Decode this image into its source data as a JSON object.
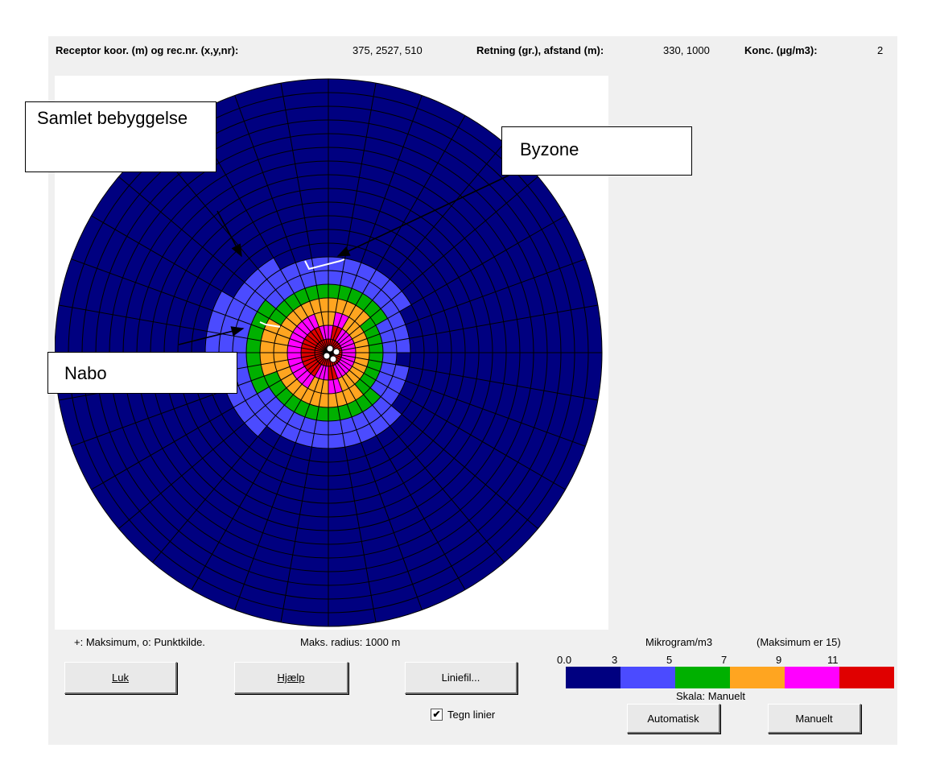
{
  "header": {
    "receptor_label": "Receptor koor. (m) og rec.nr. (x,y,nr):",
    "receptor_value": "375, 2527, 510",
    "direction_label": "Retning (gr.), afstand (m):",
    "direction_value": "330, 1000",
    "conc_label": "Konc. (µg/m3):",
    "conc_value": "2"
  },
  "callouts": {
    "samlet": "Samlet bebyggelse",
    "byzone": "Byzone",
    "nabo": "Nabo"
  },
  "status": {
    "legend_text": "+: Maksimum,  o: Punktkilde.",
    "radius_text": "Maks. radius:  1000 m"
  },
  "buttons": {
    "luk": "Luk",
    "hjaelp": "Hjælp",
    "liniefil": "Liniefil...",
    "automatisk": "Automatisk",
    "manuelt": "Manuelt"
  },
  "checkbox": {
    "label": "Tegn linier",
    "checked": true
  },
  "legend": {
    "unit": "Mikrogram/m3",
    "max_text": "(Maksimum er 15)",
    "scale_text": "Skala:  Manuelt",
    "ticks": [
      "0.0",
      "3",
      "5",
      "7",
      "9",
      "11"
    ],
    "colors": [
      "#000080",
      "#4b4bff",
      "#00b000",
      "#ffa520",
      "#ff00ff",
      "#e00000"
    ]
  },
  "plot": {
    "rings": 20,
    "sectors": 36,
    "max_radius_m": 1000,
    "background_color": "#000080",
    "grid_color": "#000000"
  }
}
